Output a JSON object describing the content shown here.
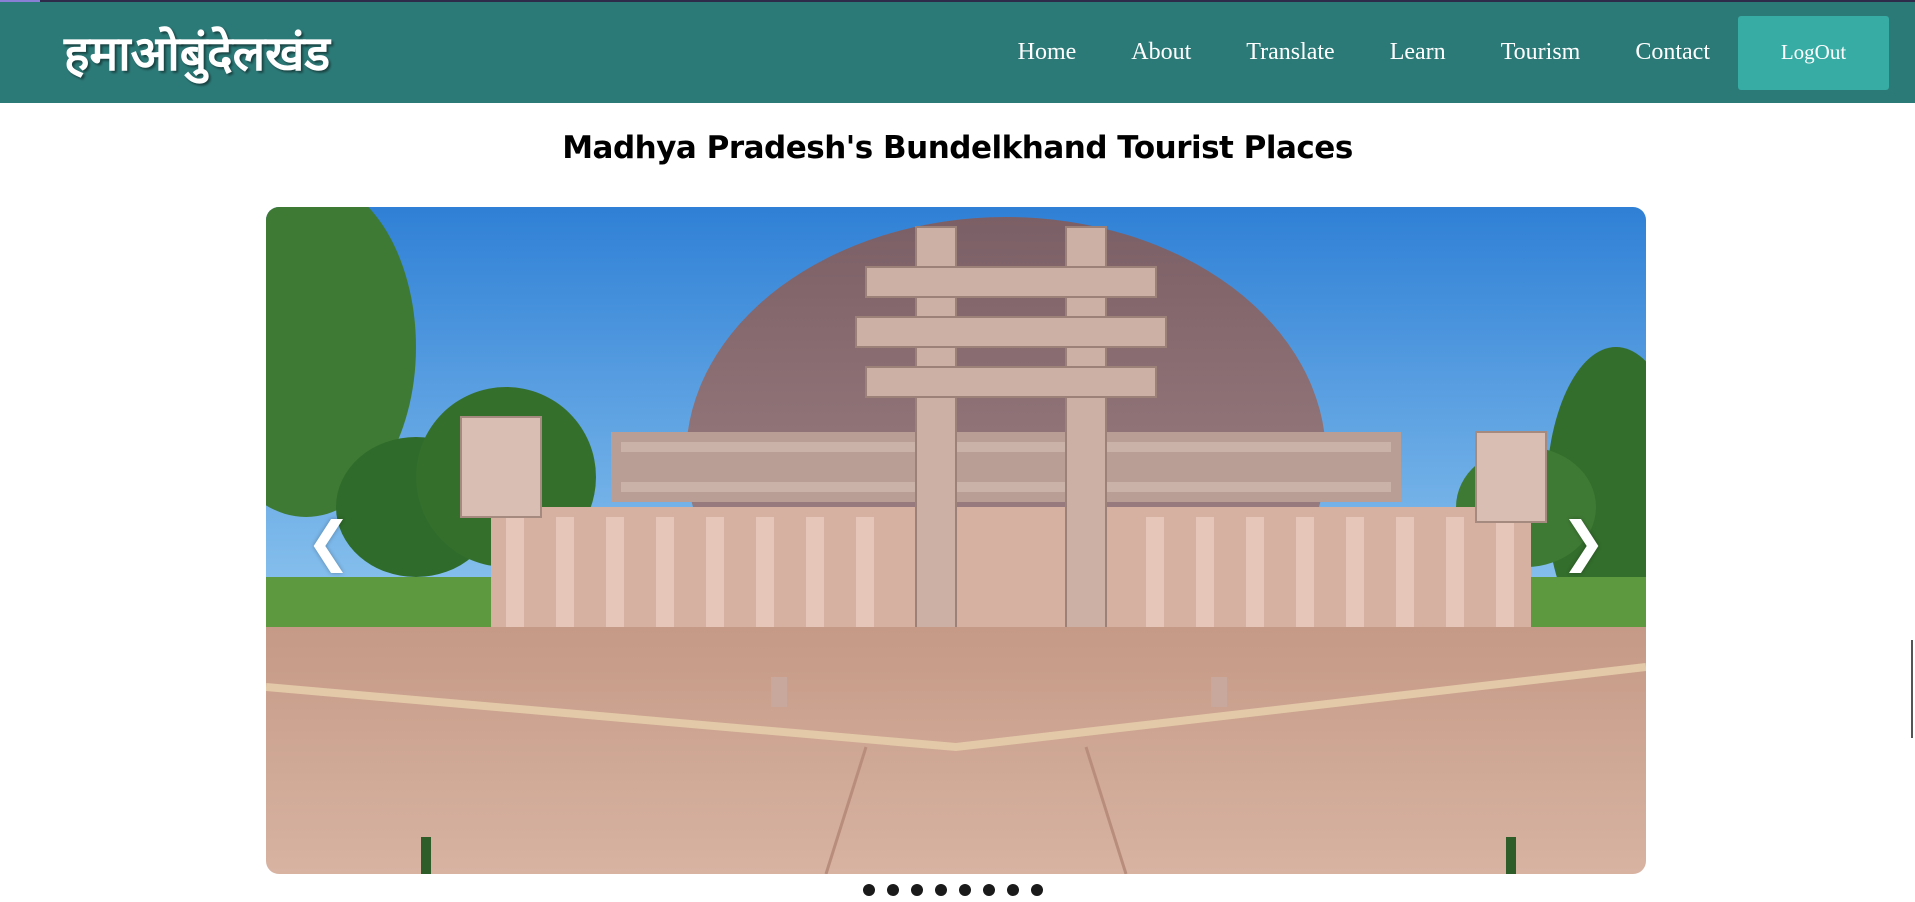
{
  "header": {
    "brand": "हमाओबुंदेलखंड",
    "nav": [
      "Home",
      "About",
      "Translate",
      "Learn",
      "Tourism",
      "Contact"
    ],
    "logout_label": "LogOut"
  },
  "main": {
    "title": "Madhya Pradesh's Bundelkhand Tourist Places",
    "slider": {
      "prev_symbol": "❮",
      "next_symbol": "❯",
      "slide_count": 8,
      "active_index": 0
    }
  },
  "colors": {
    "navbar": "#2c7a78",
    "logout_button": "#36aca4",
    "dot": "#1a1a1a"
  }
}
